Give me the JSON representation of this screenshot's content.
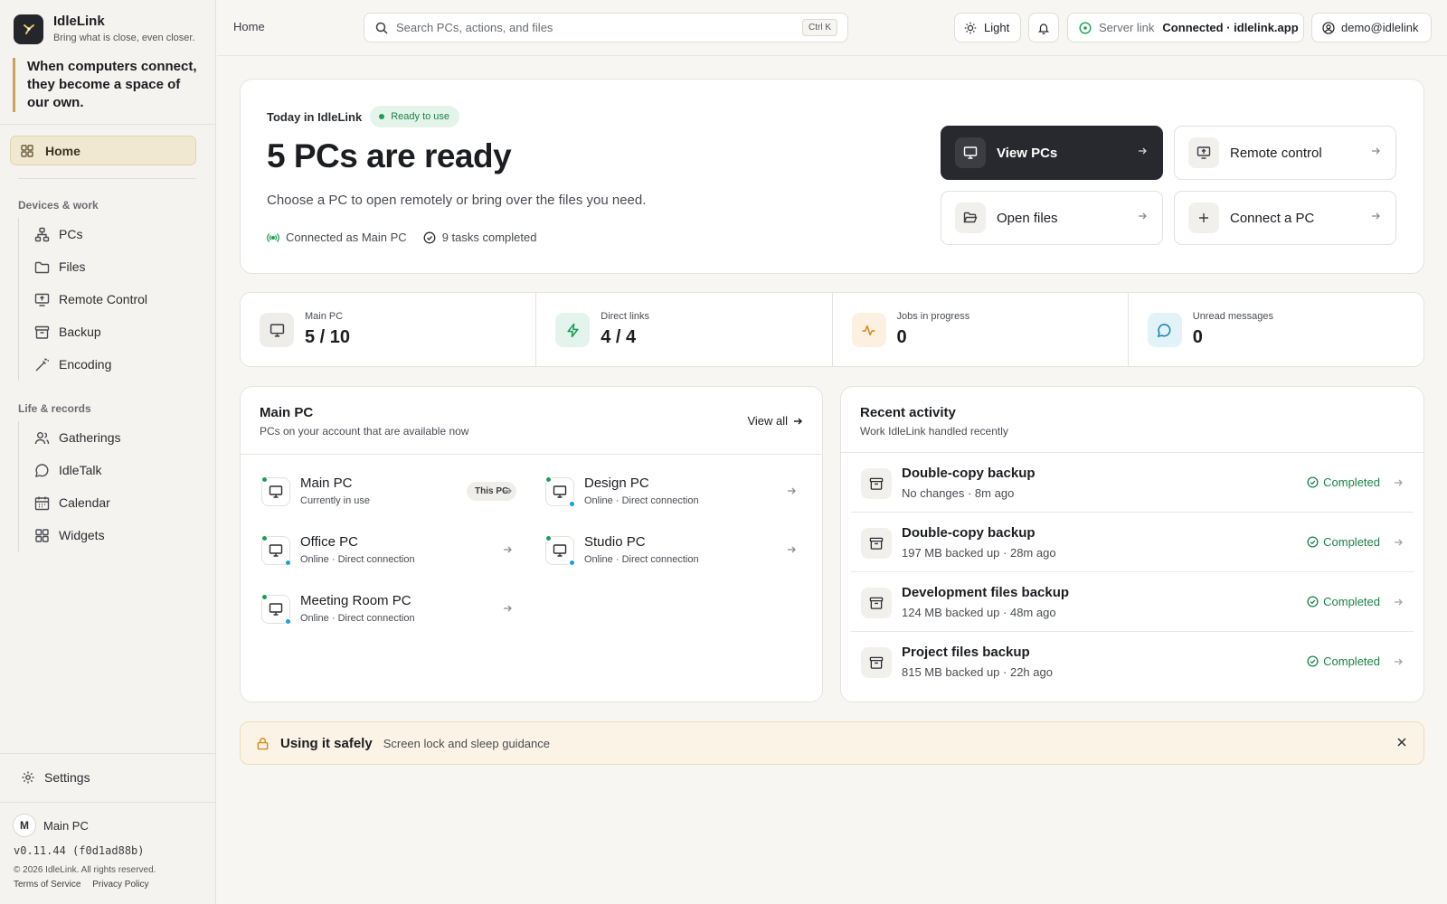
{
  "app": {
    "name": "IdleLink",
    "tagline": "Bring what is close, even closer.",
    "quote": "When computers connect, they become a space of our own."
  },
  "sidebar": {
    "home_label": "Home",
    "sections": [
      {
        "title": "Devices & work",
        "items": [
          {
            "label": "PCs",
            "icon": "network-icon"
          },
          {
            "label": "Files",
            "icon": "folder-icon"
          },
          {
            "label": "Remote Control",
            "icon": "screen-share-icon"
          },
          {
            "label": "Backup",
            "icon": "archive-icon"
          },
          {
            "label": "Encoding",
            "icon": "wand-icon"
          }
        ]
      },
      {
        "title": "Life & records",
        "items": [
          {
            "label": "Gatherings",
            "icon": "users-icon"
          },
          {
            "label": "IdleTalk",
            "icon": "chat-icon"
          },
          {
            "label": "Calendar",
            "icon": "calendar-icon"
          },
          {
            "label": "Widgets",
            "icon": "grid-icon"
          }
        ]
      }
    ],
    "settings_label": "Settings",
    "device_initial": "M",
    "device_name": "Main PC",
    "version": "v0.11.44 (f0d1ad88b)",
    "copyright": "© 2026 IdleLink. All rights reserved.",
    "terms": "Terms of Service",
    "privacy": "Privacy Policy"
  },
  "topbar": {
    "breadcrumb": "Home",
    "search_placeholder": "Search PCs, actions, and files",
    "search_shortcut": "Ctrl K",
    "theme_label": "Light",
    "server_label": "Server link",
    "server_status": "Connected · idlelink.app",
    "user": "demo@idlelink"
  },
  "hero": {
    "kicker": "Today in IdleLink",
    "badge": "Ready to use",
    "title": "5 PCs are ready",
    "subtitle": "Choose a PC to open remotely or bring over the files you need.",
    "meta_connected": "Connected as Main PC",
    "meta_tasks": "9 tasks completed",
    "actions": {
      "view_pcs": "View PCs",
      "remote_control": "Remote control",
      "open_files": "Open files",
      "connect_pc": "Connect a PC"
    }
  },
  "stats": [
    {
      "label": "Main PC",
      "value": "5 / 10",
      "icon": "monitor-icon"
    },
    {
      "label": "Direct links",
      "value": "4 / 4",
      "icon": "bolt-icon"
    },
    {
      "label": "Jobs in progress",
      "value": "0",
      "icon": "activity-icon"
    },
    {
      "label": "Unread messages",
      "value": "0",
      "icon": "message-icon"
    }
  ],
  "pc_panel": {
    "title": "Main PC",
    "subtitle": "PCs on your account that are available now",
    "view_all": "View all",
    "pcs": [
      {
        "name": "Main PC",
        "status": "Currently in use",
        "badge": "This PC"
      },
      {
        "name": "Design PC",
        "status": "Online · Direct connection"
      },
      {
        "name": "Office PC",
        "status": "Online · Direct connection"
      },
      {
        "name": "Studio PC",
        "status": "Online · Direct connection"
      },
      {
        "name": "Meeting Room PC",
        "status": "Online · Direct connection"
      }
    ]
  },
  "activity": {
    "title": "Recent activity",
    "subtitle": "Work IdleLink handled recently",
    "items": [
      {
        "name": "Double-copy backup",
        "detail": "No changes · 8m ago",
        "status": "Completed"
      },
      {
        "name": "Double-copy backup",
        "detail": "197 MB backed up · 28m ago",
        "status": "Completed"
      },
      {
        "name": "Development files backup",
        "detail": "124 MB backed up · 48m ago",
        "status": "Completed"
      },
      {
        "name": "Project files backup",
        "detail": "815 MB backed up · 22h ago",
        "status": "Completed"
      }
    ]
  },
  "banner": {
    "title": "Using it safely",
    "text": "Screen lock and sleep guidance"
  },
  "colors": {
    "accent": "#c9a35a",
    "success": "#1b8247",
    "online_dot": "#1f9d55",
    "direct_dot": "#1a9fd6",
    "primary_button": "#27292e"
  }
}
